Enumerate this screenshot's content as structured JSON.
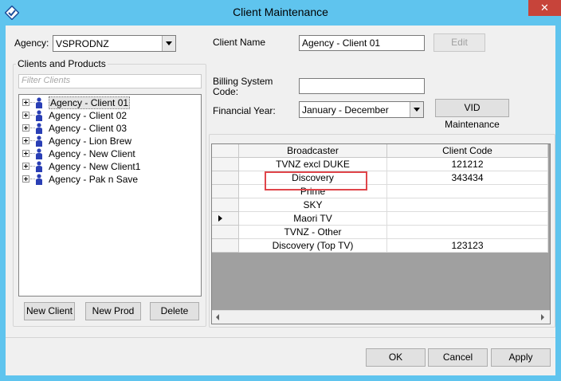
{
  "window": {
    "title": "Client Maintenance",
    "close_symbol": "✕"
  },
  "agency": {
    "label": "Agency:",
    "value": "VSPRODNZ"
  },
  "clients_products": {
    "group_title": "Clients and Products",
    "filter_placeholder": "Filter Clients",
    "items": [
      {
        "label": "Agency - Client 01"
      },
      {
        "label": "Agency - Client 02"
      },
      {
        "label": "Agency - Client 03"
      },
      {
        "label": "Agency - Lion Brew"
      },
      {
        "label": "Agency - New Client"
      },
      {
        "label": "Agency - New Client1"
      },
      {
        "label": "Agency - Pak n Save"
      }
    ],
    "selected_index": 0,
    "new_client_label": "New Client",
    "new_prod_label": "New Prod",
    "delete_label": "Delete"
  },
  "client_name": {
    "label": "Client Name",
    "value": "Agency - Client 01",
    "edit_label": "Edit"
  },
  "billing": {
    "label_line1": "Billing System",
    "label_line2": "Code:",
    "value": ""
  },
  "financial_year": {
    "label": "Financial Year:",
    "value": "January - December",
    "vid_label": "VID Maintenance"
  },
  "grid": {
    "headers": {
      "broadcaster": "Broadcaster",
      "client_code": "Client Code"
    },
    "rows": [
      {
        "broadcaster": "TVNZ excl DUKE",
        "code": "121212"
      },
      {
        "broadcaster": "Discovery",
        "code": "343434"
      },
      {
        "broadcaster": "Prime",
        "code": ""
      },
      {
        "broadcaster": "SKY",
        "code": ""
      },
      {
        "broadcaster": "Maori TV",
        "code": ""
      },
      {
        "broadcaster": "TVNZ - Other",
        "code": ""
      },
      {
        "broadcaster": "Discovery (Top TV)",
        "code": "123123"
      }
    ],
    "current_row_index": 4
  },
  "footer": {
    "ok_label": "OK",
    "cancel_label": "Cancel",
    "apply_label": "Apply"
  },
  "colors": {
    "titlebar": "#5fc4ee",
    "close_button": "#c7443a",
    "highlight_box": "#e0454a",
    "person_icon": "#2a3fb5"
  }
}
